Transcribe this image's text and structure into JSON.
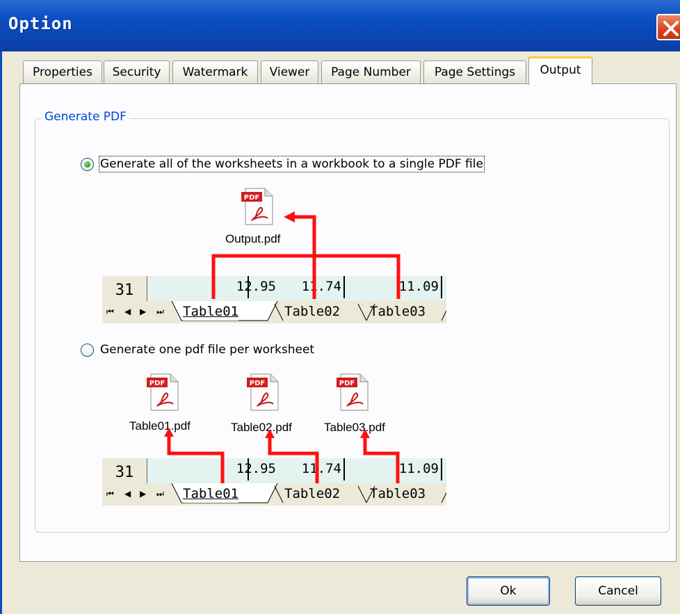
{
  "window": {
    "title": "Option"
  },
  "tabs": [
    {
      "label": "Properties",
      "active": false
    },
    {
      "label": "Security",
      "active": false
    },
    {
      "label": "Watermark",
      "active": false
    },
    {
      "label": "Viewer",
      "active": false
    },
    {
      "label": "Page Number",
      "active": false
    },
    {
      "label": "Page Settings",
      "active": false
    },
    {
      "label": "Output",
      "active": true
    }
  ],
  "group": {
    "title": "Generate PDF"
  },
  "options": {
    "single": {
      "label": "Generate all of the worksheets in a workbook to a single PDF file",
      "checked": true
    },
    "per_sheet": {
      "label": "Generate one pdf file per worksheet",
      "checked": false
    }
  },
  "diagram_single": {
    "output_file": "Output.pdf",
    "icon_text": "PDF",
    "row_number": "31",
    "cells": [
      "12.95",
      "11.74",
      "11.09"
    ],
    "sheets": [
      "Table01",
      "Table02",
      "Table03"
    ]
  },
  "diagram_per_sheet": {
    "files": [
      "Table01.pdf",
      "Table02.pdf",
      "Table03.pdf"
    ],
    "icon_text": "PDF",
    "row_number": "31",
    "cells": [
      "12.95",
      "11.74",
      "11.09"
    ],
    "sheets": [
      "Table01",
      "Table02",
      "Table03"
    ]
  },
  "buttons": {
    "ok": "Ok",
    "cancel": "Cancel"
  },
  "colors": {
    "titlebar": "#0b45b4",
    "arrow": "#ff0000",
    "group_title": "#0046d5",
    "active_tab_accent": "#ffc83c"
  }
}
